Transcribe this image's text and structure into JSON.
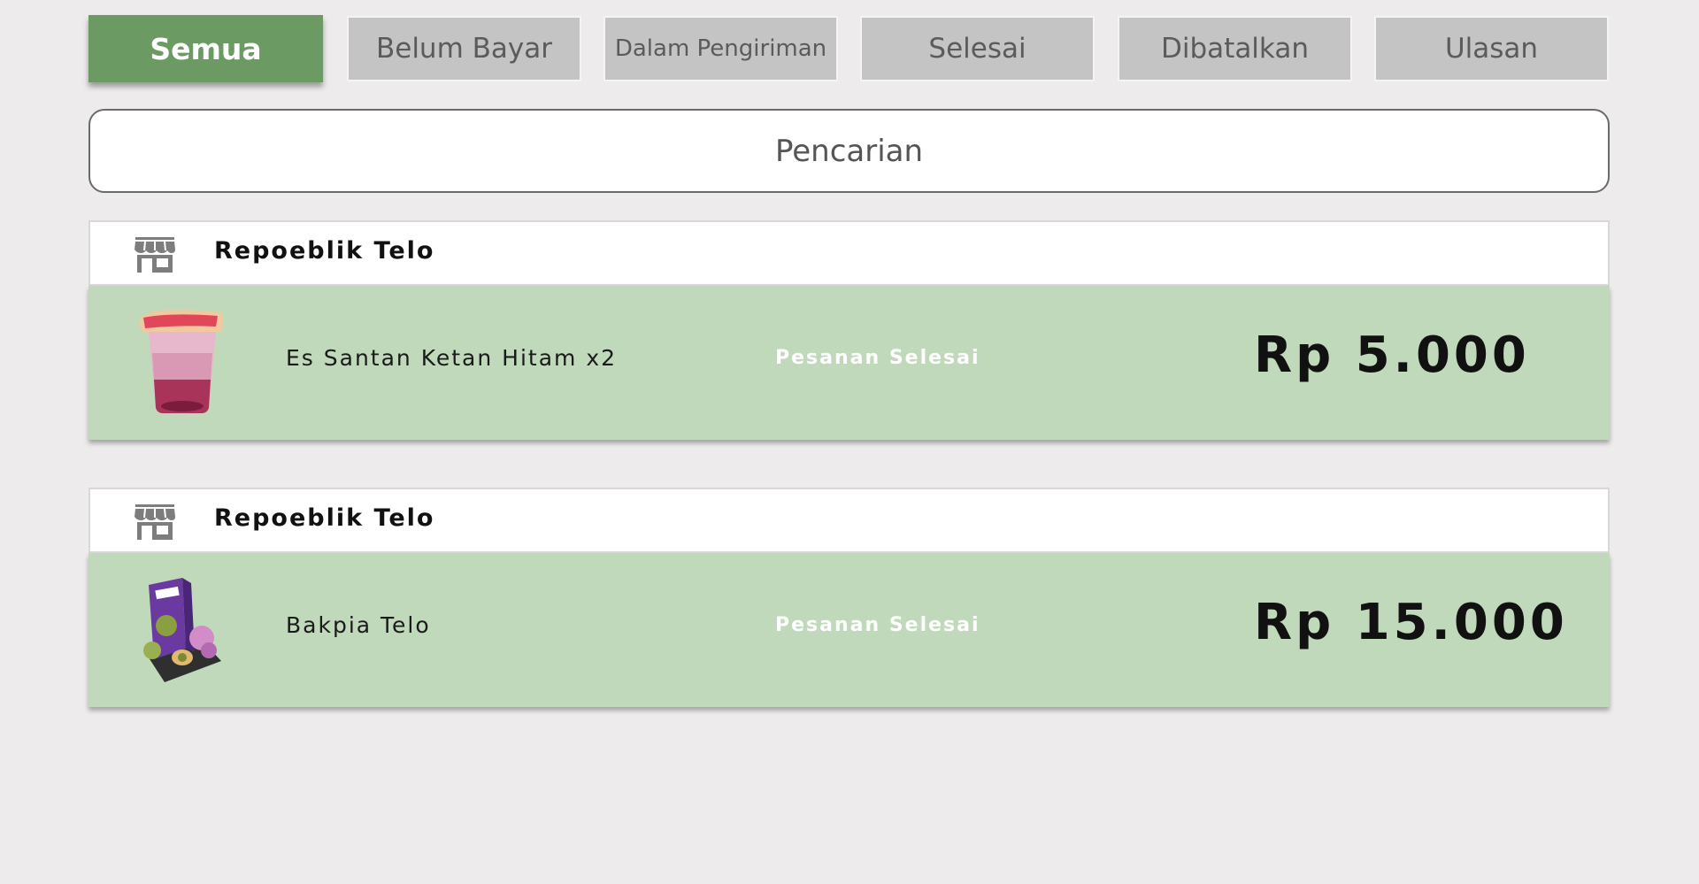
{
  "tabs": [
    {
      "label": "Semua",
      "active": true
    },
    {
      "label": "Belum Bayar",
      "active": false
    },
    {
      "label": "Dalam Pengiriman",
      "active": false
    },
    {
      "label": "Selesai",
      "active": false
    },
    {
      "label": "Dibatalkan",
      "active": false
    },
    {
      "label": "Ulasan",
      "active": false
    }
  ],
  "search": {
    "placeholder": "Pencarian"
  },
  "orders": [
    {
      "store": "Repoeblik Telo",
      "store_icon": "store-icon",
      "product": "Es Santan Ketan Hitam x2",
      "status": "Pesanan Selesai",
      "price": "Rp 5.000",
      "thumb": "drink-cup-thumbnail"
    },
    {
      "store": "Repoeblik Telo",
      "store_icon": "store-icon",
      "product": "Bakpia Telo",
      "status": "Pesanan Selesai",
      "price": "Rp 15.000",
      "thumb": "bakpia-box-thumbnail"
    }
  ],
  "colors": {
    "background": "#edebec",
    "tab_active": "#6b9a62",
    "tab_inactive": "#c4c4c4",
    "order_body": "#c0d9bb"
  }
}
